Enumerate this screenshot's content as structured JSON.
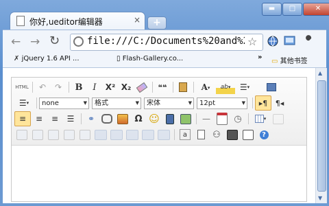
{
  "browser": {
    "tab_title": "你好,ueditor编辑器",
    "tab_close": "×",
    "new_tab": "+",
    "address": "file:///C:/Documents%20and%20S",
    "window_buttons": {
      "minimize": "▬",
      "maximize": "□",
      "close": "✕"
    }
  },
  "bookmarks": {
    "items": [
      "jQuery 1.6 API ...",
      "Flash-Gallery.co..."
    ],
    "more": "»",
    "other": "其他书签"
  },
  "editor": {
    "toolbar_row1": {
      "source": "HTML",
      "bold": "B",
      "italic": "I",
      "quote": "❝❝"
    },
    "toolbar_row2": {
      "heading": "none",
      "paragraph": "格式",
      "font_family": "宋体",
      "font_size": "12pt"
    },
    "toolbar_row3": {
      "link": "⚭",
      "omega": "Ω",
      "smile": "☺"
    }
  },
  "colors": {
    "accent": "#5b8fcf",
    "editor_border": "#c9c9c9"
  }
}
